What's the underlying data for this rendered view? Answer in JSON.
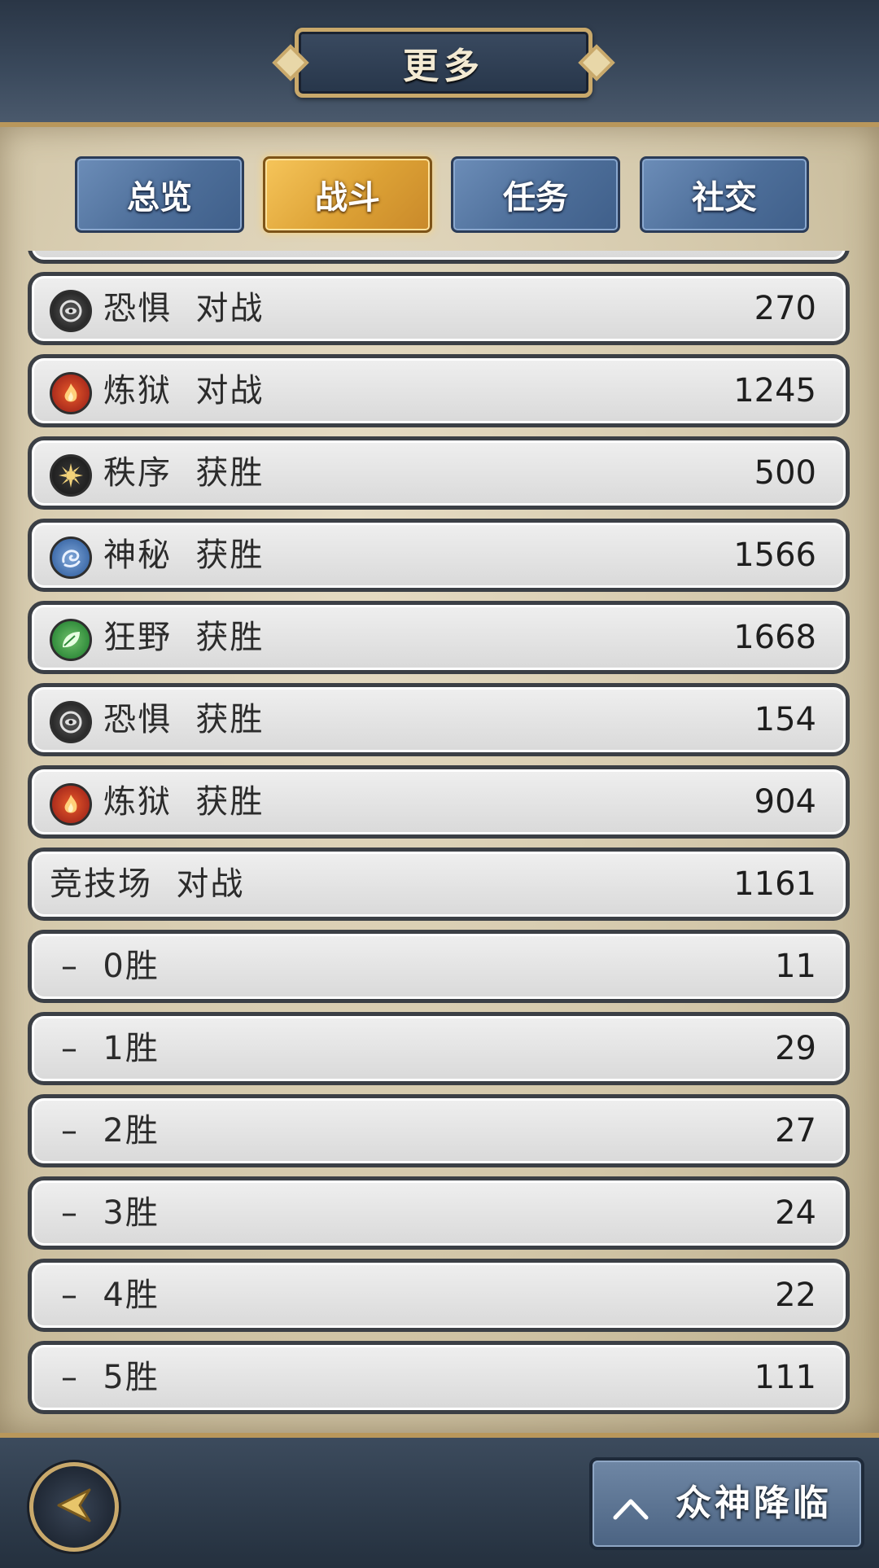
{
  "header": {
    "title": "更多"
  },
  "tabs": [
    {
      "label": "总览",
      "active": false
    },
    {
      "label": "战斗",
      "active": true
    },
    {
      "label": "任务",
      "active": false
    },
    {
      "label": "社交",
      "active": false
    }
  ],
  "rows": [
    {
      "icon": "fear-icon",
      "label": "恐惧  对战",
      "value": "270"
    },
    {
      "icon": "fire-icon",
      "label": "炼狱  对战",
      "value": "1245"
    },
    {
      "icon": "order-sun-icon",
      "label": "秩序  获胜",
      "value": "500"
    },
    {
      "icon": "mystery-swirl-icon",
      "label": "神秘  获胜",
      "value": "1566"
    },
    {
      "icon": "wild-leaf-icon",
      "label": "狂野  获胜",
      "value": "1668"
    },
    {
      "icon": "fear-icon",
      "label": "恐惧  获胜",
      "value": "154"
    },
    {
      "icon": "fire-icon",
      "label": "炼狱  获胜",
      "value": "904"
    },
    {
      "icon": null,
      "label": "竞技场  对战",
      "value": "1161"
    },
    {
      "icon": null,
      "label": "–  0胜",
      "value": "11",
      "sub": true
    },
    {
      "icon": null,
      "label": "–  1胜",
      "value": "29",
      "sub": true
    },
    {
      "icon": null,
      "label": "–  2胜",
      "value": "27",
      "sub": true
    },
    {
      "icon": null,
      "label": "–  3胜",
      "value": "24",
      "sub": true
    },
    {
      "icon": null,
      "label": "–  4胜",
      "value": "22",
      "sub": true
    },
    {
      "icon": null,
      "label": "–  5胜",
      "value": "111",
      "sub": true
    }
  ],
  "footer": {
    "back_icon": "back-arrow-icon",
    "gods_button": "众神降临",
    "gods_icon": "chevron-up-icon"
  },
  "colors": {
    "active_tab": "#dca135",
    "inactive_tab": "#4d6e99",
    "row_bg": "#dcdcdc",
    "frame_gold": "#c9a96b"
  }
}
